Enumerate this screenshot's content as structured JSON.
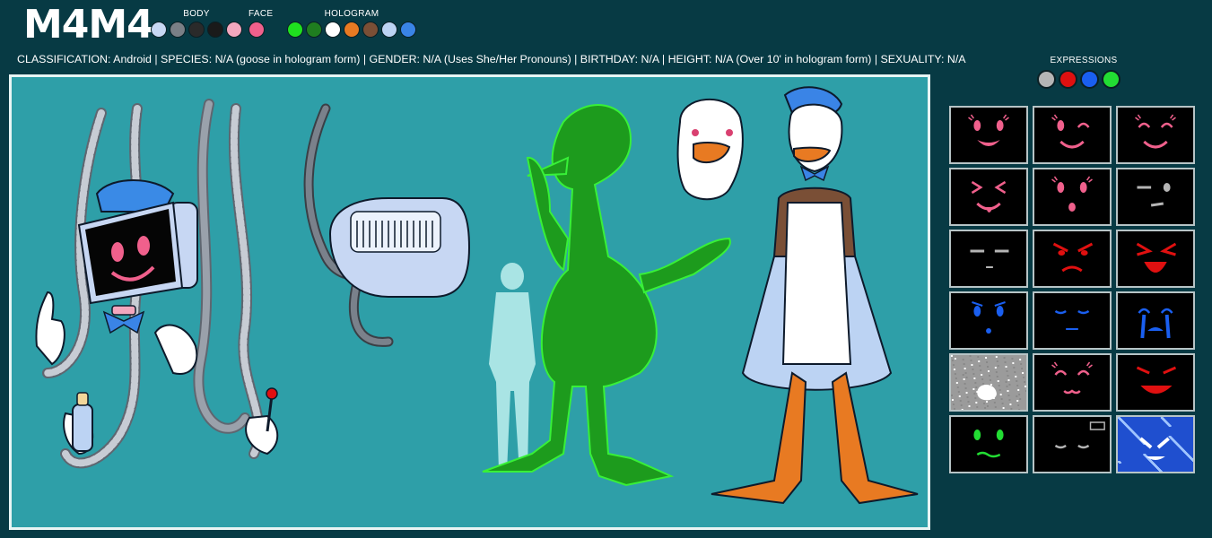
{
  "header": {
    "title": "M4M4"
  },
  "palettes": [
    {
      "label": "BODY",
      "colors": [
        "#c7d7f3",
        "#7a7f86",
        "#2a2a2a",
        "#1a1a1a",
        "#f3a7be"
      ]
    },
    {
      "label": "FACE",
      "colors": [
        "#f0608c"
      ]
    },
    {
      "label": "HOLOGRAM",
      "colors": [
        "#1fe01f",
        "#1f7d1f",
        "#ffffff",
        "#e87a22",
        "#7a4f36",
        "#bcd3f3",
        "#3a84e6"
      ]
    }
  ],
  "info": {
    "text": "CLASSIFICATION: Android | SPECIES: N/A (goose in hologram form) | GENDER: N/A (Uses She/Her Pronouns) | BIRTHDAY: N/A | HEIGHT: N/A (Over 10'  in hologram form) | SEXUALITY: N/A"
  },
  "expressions": {
    "title": "EXPRESSIONS",
    "colors": [
      "#b5b5b5",
      "#e01010",
      "#1a5ff0",
      "#22dd33"
    ],
    "faces": [
      {
        "name": "smile",
        "color": "#f0608c"
      },
      {
        "name": "wink",
        "color": "#f0608c"
      },
      {
        "name": "happy-closed",
        "color": "#f0608c"
      },
      {
        "name": "tongue-out",
        "color": "#f0608c"
      },
      {
        "name": "surprised",
        "color": "#f0608c"
      },
      {
        "name": "skeptical",
        "color": "#b5b5b5"
      },
      {
        "name": "neutral-flat",
        "color": "#b5b5b5"
      },
      {
        "name": "angry",
        "color": "#e01010"
      },
      {
        "name": "shouting",
        "color": "#e01010"
      },
      {
        "name": "sad",
        "color": "#1a5ff0"
      },
      {
        "name": "sleepy",
        "color": "#1a5ff0"
      },
      {
        "name": "crying",
        "color": "#1a5ff0"
      },
      {
        "name": "static",
        "color": "#cccccc"
      },
      {
        "name": "cat-smirk",
        "color": "#f0608c"
      },
      {
        "name": "evil-grin",
        "color": "#e01010"
      },
      {
        "name": "sick",
        "color": "#22dd33"
      },
      {
        "name": "sleeping",
        "color": "#b5b5b5"
      },
      {
        "name": "error",
        "color": "#ffffff"
      }
    ]
  }
}
